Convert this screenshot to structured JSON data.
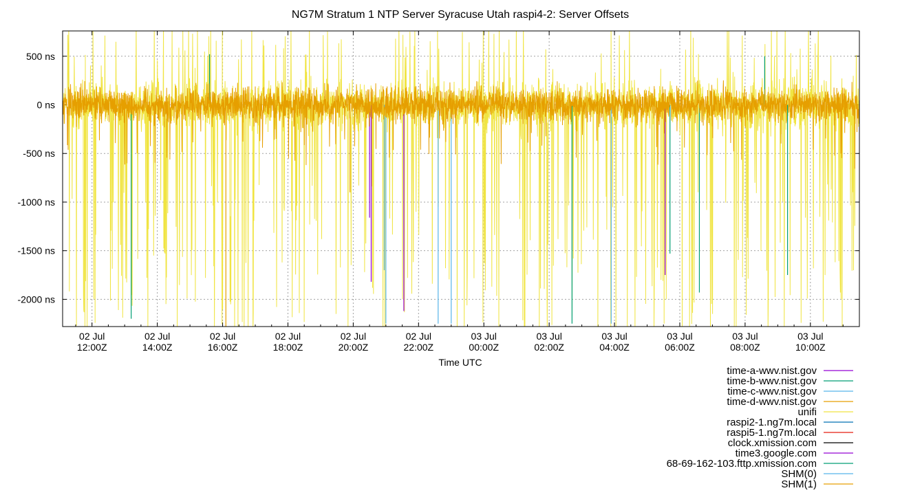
{
  "chart_data": {
    "type": "line",
    "title": "NG7M Stratum 1 NTP Server Syracuse Utah raspi4-2: Server Offsets",
    "xlabel": "Time UTC",
    "ylabel": "",
    "ylim": [
      -2280,
      760
    ],
    "y_ticks": [
      {
        "value": 500,
        "label": "500 ns"
      },
      {
        "value": 0,
        "label": "0 ns"
      },
      {
        "value": -500,
        "label": "-500 ns"
      },
      {
        "value": -1000,
        "label": "-1000 ns"
      },
      {
        "value": -1500,
        "label": "-1500 ns"
      },
      {
        "value": -2000,
        "label": "-2000 ns"
      }
    ],
    "x_range_hours": [
      11.1,
      11.5
    ],
    "x_ticks": [
      {
        "hour": 12,
        "date": "02 Jul",
        "time": "12:00Z"
      },
      {
        "hour": 14,
        "date": "02 Jul",
        "time": "14:00Z"
      },
      {
        "hour": 16,
        "date": "02 Jul",
        "time": "16:00Z"
      },
      {
        "hour": 18,
        "date": "02 Jul",
        "time": "18:00Z"
      },
      {
        "hour": 20,
        "date": "02 Jul",
        "time": "20:00Z"
      },
      {
        "hour": 22,
        "date": "02 Jul",
        "time": "22:00Z"
      },
      {
        "hour": 24,
        "date": "03 Jul",
        "time": "00:00Z"
      },
      {
        "hour": 26,
        "date": "03 Jul",
        "time": "02:00Z"
      },
      {
        "hour": 28,
        "date": "03 Jul",
        "time": "04:00Z"
      },
      {
        "hour": 30,
        "date": "03 Jul",
        "time": "06:00Z"
      },
      {
        "hour": 32,
        "date": "03 Jul",
        "time": "08:00Z"
      },
      {
        "hour": 34,
        "date": "03 Jul",
        "time": "10:00Z"
      }
    ],
    "grid": true,
    "legend_position": "bottom-right",
    "series": [
      {
        "name": "time-a-wwv.nist.gov",
        "color": "#9400d3"
      },
      {
        "name": "time-b-wwv.nist.gov",
        "color": "#009e73"
      },
      {
        "name": "time-c-wwv.nist.gov",
        "color": "#56b4e9"
      },
      {
        "name": "time-d-wwv.nist.gov",
        "color": "#e69f00"
      },
      {
        "name": "unifi",
        "color": "#f0e442"
      },
      {
        "name": "raspi2-1.ng7m.local",
        "color": "#0072b2"
      },
      {
        "name": "raspi5-1.ng7m.local",
        "color": "#e51e10"
      },
      {
        "name": "clock.xmission.com",
        "color": "#000000"
      },
      {
        "name": "time3.google.com",
        "color": "#9400d3"
      },
      {
        "name": "68-69-162-103.fttp.xmission.com",
        "color": "#009e73"
      },
      {
        "name": "SHM(0)",
        "color": "#56b4e9"
      },
      {
        "name": "SHM(1)",
        "color": "#e69f00"
      }
    ],
    "spikes": [
      {
        "series": 0,
        "hour": 20.55,
        "value": -1820
      },
      {
        "series": 0,
        "hour": 21.55,
        "value": -2120
      },
      {
        "series": 0,
        "hour": 29.55,
        "value": -1750
      },
      {
        "series": 0,
        "hour": 20.5,
        "value": -1160
      },
      {
        "series": 1,
        "hour": 13.2,
        "value": -2200
      },
      {
        "series": 1,
        "hour": 26.7,
        "value": -2250
      },
      {
        "series": 1,
        "hour": 29.7,
        "value": -1530
      },
      {
        "series": 1,
        "hour": 30.6,
        "value": -1930
      },
      {
        "series": 1,
        "hour": 33.3,
        "value": -1750
      },
      {
        "series": 1,
        "hour": 15.6,
        "value": 520
      },
      {
        "series": 1,
        "hour": 32.6,
        "value": 500
      },
      {
        "series": 2,
        "hour": 20.95,
        "value": -1700
      },
      {
        "series": 2,
        "hour": 21.0,
        "value": -2250
      },
      {
        "series": 2,
        "hour": 22.6,
        "value": -2250
      },
      {
        "series": 2,
        "hour": 27.9,
        "value": -2250
      },
      {
        "series": 2,
        "hour": 23.0,
        "value": -2250
      },
      {
        "series": 3,
        "hour": 16.1,
        "value": -2280
      },
      {
        "series": 3,
        "hour": 19.9,
        "value": -900
      }
    ]
  }
}
